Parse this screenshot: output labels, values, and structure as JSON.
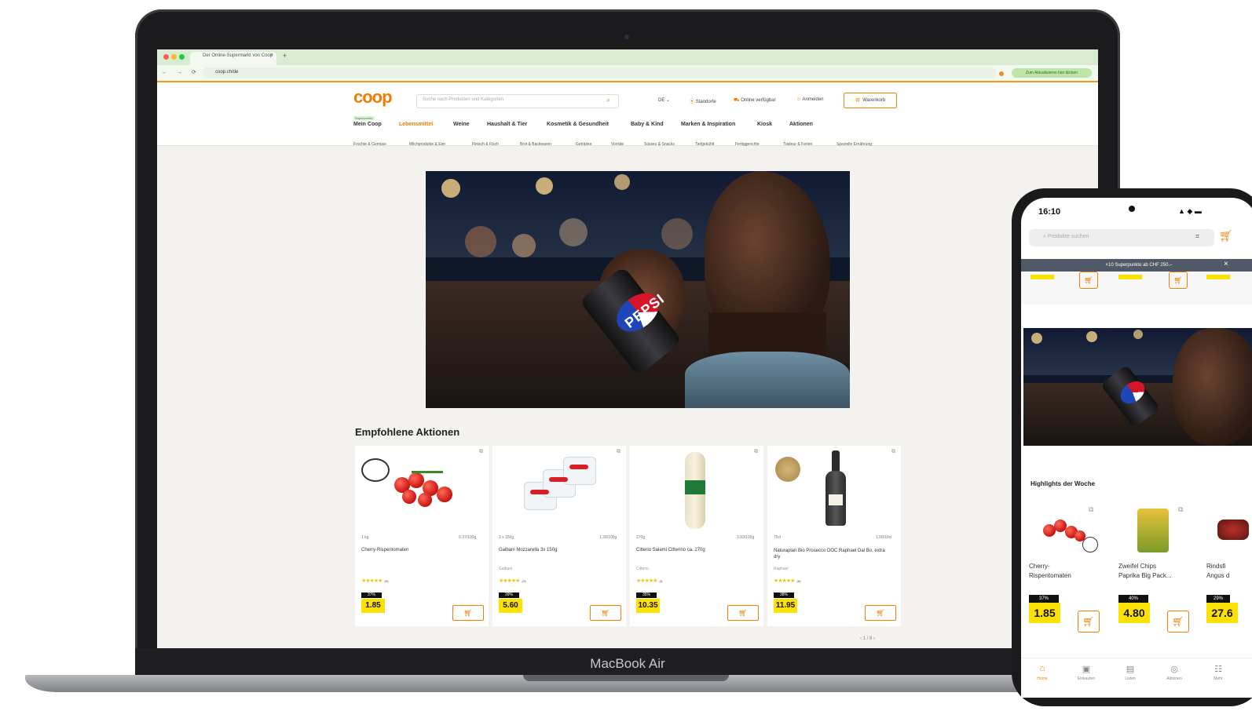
{
  "device": {
    "laptop_label": "MacBook Air"
  },
  "browser": {
    "tab_title": "Der Online-Supermarkt von Coop",
    "url": "coop.ch/de",
    "promo_button": "Zum Aktualisieren hier klicken"
  },
  "site": {
    "logo": "coop",
    "search_placeholder": "Suche nach Produkten und Kategorien",
    "language": "DE",
    "header_links": [
      "Standorte",
      "Online verfügbar",
      "Anmelden"
    ],
    "cart_label": "Warenkorb",
    "mein_coop_badge": "Superpunkte",
    "categories": [
      "Mein Coop",
      "Lebensmittel",
      "Weine",
      "Haushalt & Tier",
      "Kosmetik & Gesundheit",
      "Baby & Kind",
      "Marken & Inspiration",
      "Kiosk",
      "Aktionen"
    ],
    "active_category": "Lebensmittel",
    "subcategories": [
      "Früchte & Gemüse",
      "Milchprodukte & Eier",
      "Fleisch & Fisch",
      "Brot & Backwaren",
      "Getränke",
      "Vorräte",
      "Süsses & Snacks",
      "Tiefgekühlt",
      "Fertiggerichte",
      "Traiteur & Ferien",
      "Spezielle Ernährung"
    ]
  },
  "hero": {
    "brand_text": "PEPSI"
  },
  "section": {
    "title": "Empfohlene Aktionen",
    "pager": "1 / 8",
    "products": [
      {
        "qty": "1 kg",
        "unit_price": "0.37/100g",
        "name": "Cherry-Rispentomaten",
        "brand": "",
        "reviews": "(296)",
        "discount": "37%",
        "price": "1.85"
      },
      {
        "qty": "3 x 150g",
        "unit_price": "1.28/100g",
        "name": "Galbani Mozzarella 3x 150g",
        "brand": "Galbani",
        "reviews": "(279)",
        "discount": "39%",
        "price": "5.60"
      },
      {
        "qty": "270g",
        "unit_price": "3.83/100g",
        "name": "Citterio Salami Citterino ca. 270g",
        "brand": "Citterio",
        "reviews": "(46)",
        "discount": "35%",
        "price": "10.35"
      },
      {
        "qty": "75cl",
        "unit_price": "1.58/10cl",
        "name": "Naturaplan Bio Prosecco DOC Raphael Dal Bo, extra dry",
        "brand": "Raphael",
        "reviews": "(398)",
        "discount": "38%",
        "price": "11.95"
      }
    ]
  },
  "phone": {
    "time": "16:10",
    "status_icons": "▲ ◆ ▬",
    "search_placeholder": "Produkte suchen",
    "banner": "×10 Superpunkte ab CHF 250.–",
    "section_title": "Highlights der Woche",
    "products": [
      {
        "name_line1": "Cherry-",
        "name_line2": "Rispentomaten",
        "discount": "37%",
        "price": "1.85"
      },
      {
        "name_line1": "Zweifel Chips",
        "name_line2": "Paprika Big Pack...",
        "discount": "40%",
        "price": "4.80"
      },
      {
        "name_line1": "Rindsfi",
        "name_line2": "Angus d",
        "discount": "29%",
        "price": "27.6"
      }
    ],
    "tabs": [
      "Home",
      "Einkaufen",
      "Listen",
      "Aktionen",
      "Mehr"
    ]
  },
  "colors": {
    "brand": "#f07d00",
    "price_yellow": "#fde100"
  }
}
